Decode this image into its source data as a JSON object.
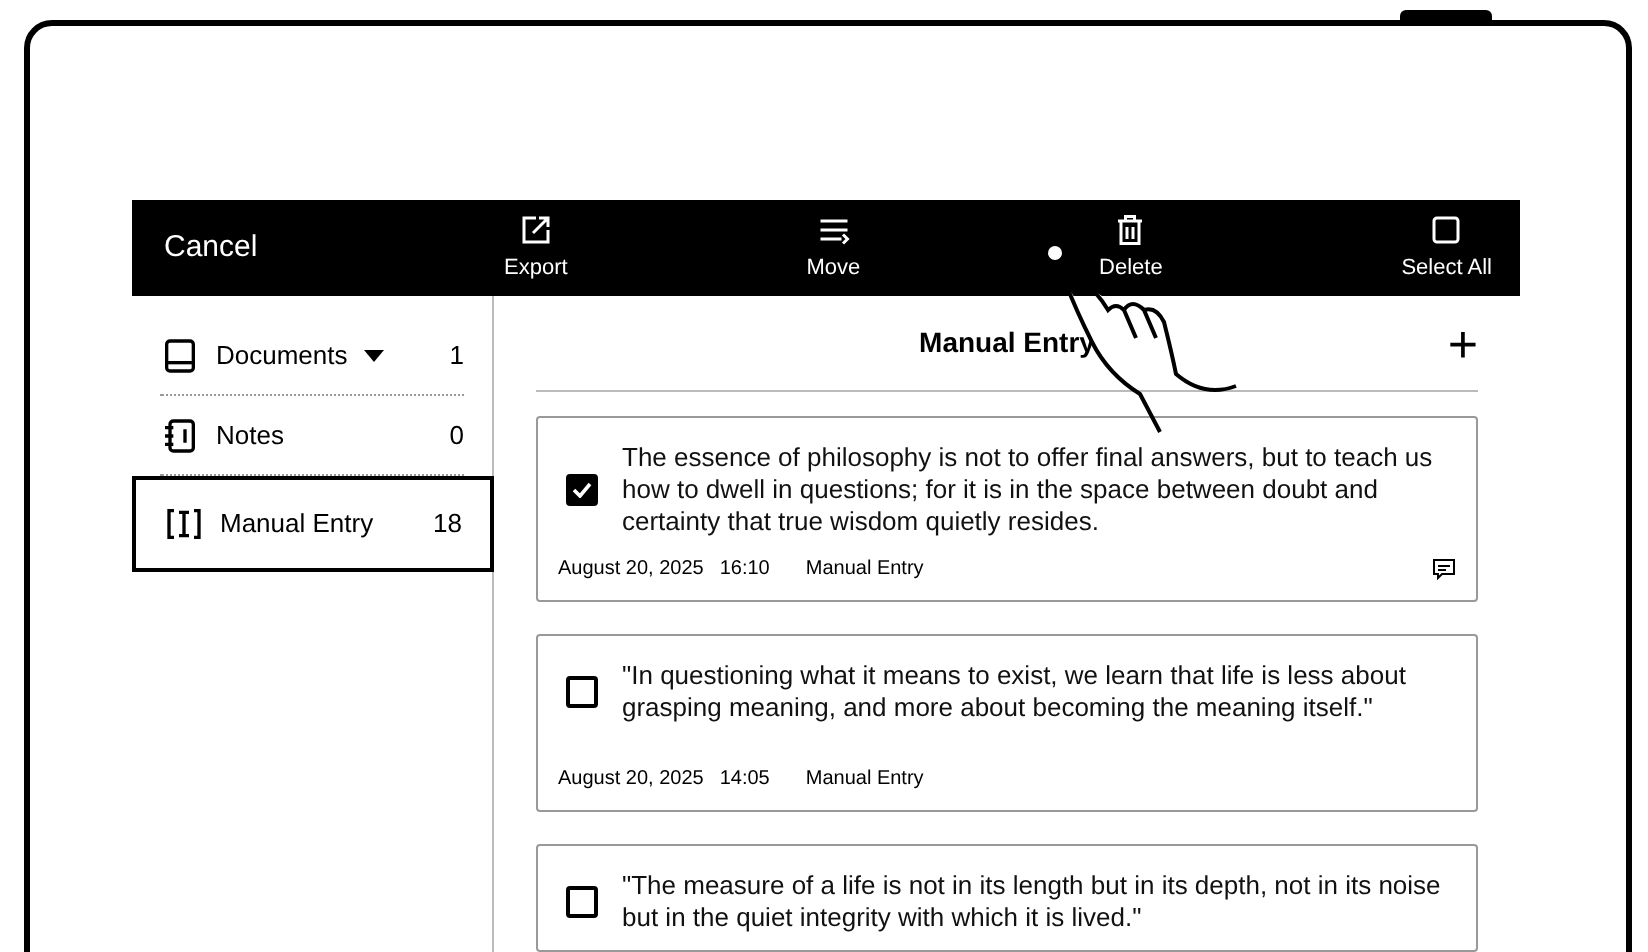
{
  "toolbar": {
    "cancel": "Cancel",
    "actions": [
      {
        "kind": "export",
        "label": "Export"
      },
      {
        "kind": "move",
        "label": "Move"
      },
      {
        "kind": "delete",
        "label": "Delete"
      },
      {
        "kind": "select_all",
        "label": "Select All"
      }
    ]
  },
  "sidebar": {
    "items": [
      {
        "kind": "documents",
        "label": "Documents",
        "count": "1",
        "selected": false,
        "dropdown": true
      },
      {
        "kind": "notes",
        "label": "Notes",
        "count": "0",
        "selected": false,
        "dropdown": false
      },
      {
        "kind": "manual",
        "label": "Manual Entry",
        "count": "18",
        "selected": true,
        "dropdown": false
      }
    ]
  },
  "content": {
    "title": "Manual Entry",
    "add": "+",
    "cards": [
      {
        "text": "The essence of philosophy is not to offer final answers, but to teach us how to dwell in questions; for it is in the space between doubt and certainty that true wisdom quietly resides.",
        "checked": true,
        "date": "August 20, 2025",
        "time": "16:10",
        "source": "Manual Entry",
        "has_note": true
      },
      {
        "text": "\"In questioning what it means to exist, we learn that life is less about grasping meaning, and more about becoming the meaning itself.\"",
        "checked": false,
        "date": "August 20, 2025",
        "time": "14:05",
        "source": "Manual Entry",
        "has_note": false
      },
      {
        "text": "\"The measure of a life is not in its length but in its depth, not in its noise but in the quiet integrity with which it is lived.\"",
        "checked": false
      }
    ]
  }
}
